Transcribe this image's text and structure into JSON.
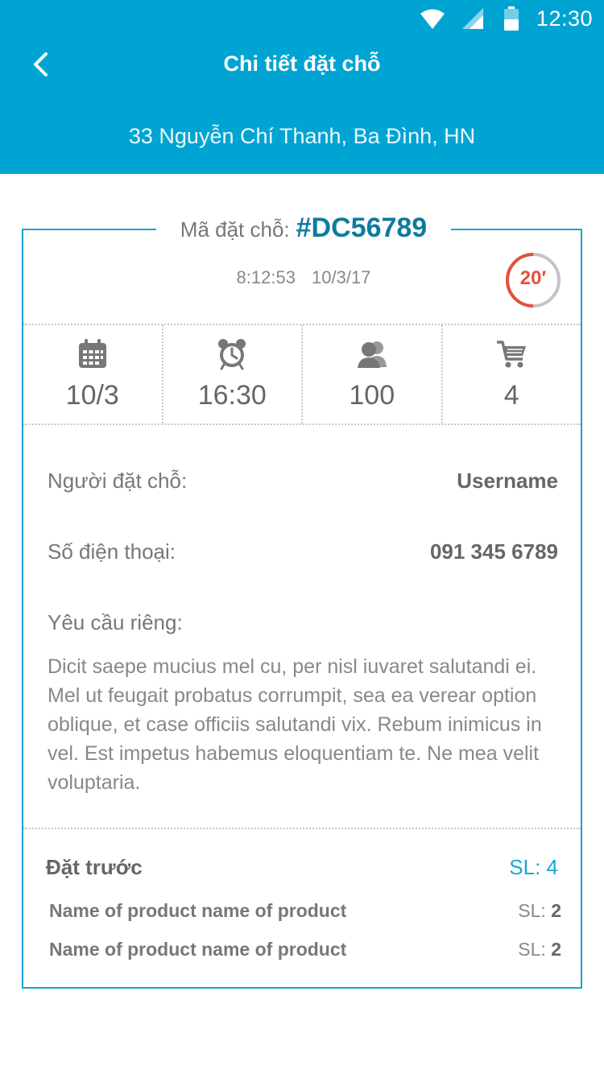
{
  "status_bar": {
    "time": "12:30",
    "icons": [
      "wifi-icon",
      "signal-icon",
      "battery-icon"
    ]
  },
  "header": {
    "title": "Chi tiết đặt chỗ",
    "address": "33 Nguyễn Chí Thanh, Ba Đình, HN",
    "back_icon": "chevron-left-icon",
    "background_color": "#00a4d3"
  },
  "booking": {
    "code_label": "Mã đặt chỗ:",
    "code": "#DC56789",
    "timestamp": "8:12:53 10/3/17",
    "timer": {
      "label": "20′",
      "progress": 0.5,
      "color": "#e0533d"
    }
  },
  "stats": [
    {
      "icon": "calendar-icon",
      "value": "10/3"
    },
    {
      "icon": "alarm-clock-icon",
      "value": "16:30"
    },
    {
      "icon": "users-icon",
      "value": "100"
    },
    {
      "icon": "cart-icon",
      "value": "4"
    }
  ],
  "details": {
    "booker_label": "Người đặt chỗ:",
    "booker_value": "Username",
    "phone_label": "Số điện thoại:",
    "phone_value": "091 345 6789",
    "note_label": "Yêu cầu riêng:",
    "note_text": "Dicit saepe mucius mel cu, per nisl iuvaret salutandi ei. Mel ut feugait probatus corrumpit, sea ea verear option oblique, et case officiis salutandi vix. Rebum inimicus in vel. Est impetus habemus eloquentiam te. Ne mea velit voluptaria."
  },
  "preorder": {
    "title": "Đặt trước",
    "total": "SL: 4",
    "qty_label": "SL:",
    "items": [
      {
        "name": "Name of product name of product",
        "qty": "2"
      },
      {
        "name": "Name of product name of product",
        "qty": "2"
      }
    ]
  },
  "colors": {
    "accent": "#00a4d3",
    "code": "#0e7a9e",
    "timer": "#e0533d"
  }
}
